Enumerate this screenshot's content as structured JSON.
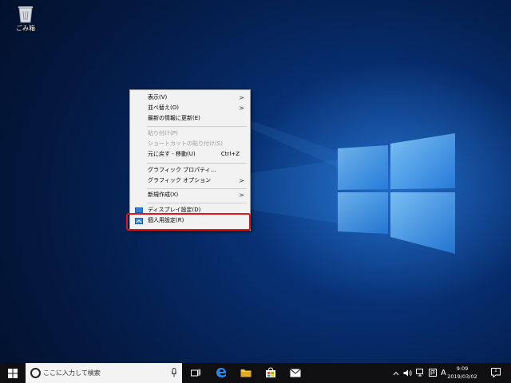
{
  "desktop": {
    "recycle_bin_label": "ごみ箱"
  },
  "context_menu": {
    "items": [
      {
        "label": "表示(V)",
        "submenu": true
      },
      {
        "label": "並べ替え(O)",
        "submenu": true
      },
      {
        "label": "最新の情報に更新(E)"
      },
      {
        "label": "貼り付け(P)",
        "disabled": true
      },
      {
        "label": "ショートカットの貼り付け(S)",
        "disabled": true
      },
      {
        "label": "元に戻す - 移動(U)",
        "shortcut": "Ctrl+Z"
      },
      {
        "label": "グラフィック プロパティ..."
      },
      {
        "label": "グラフィック オプション",
        "submenu": true
      },
      {
        "label": "新規作成(X)",
        "submenu": true
      },
      {
        "label": "ディスプレイ設定(D)"
      },
      {
        "label": "個人用設定(R)"
      }
    ],
    "arrow": ">"
  },
  "taskbar": {
    "search_placeholder": "ここに入力して検索",
    "ime_indicator": "A",
    "time": "9:09",
    "date": "2019/03/02",
    "notification_count": "1"
  },
  "colors": {
    "highlight_border": "#e0161b",
    "desktop_blue": "#0a3f8a"
  }
}
